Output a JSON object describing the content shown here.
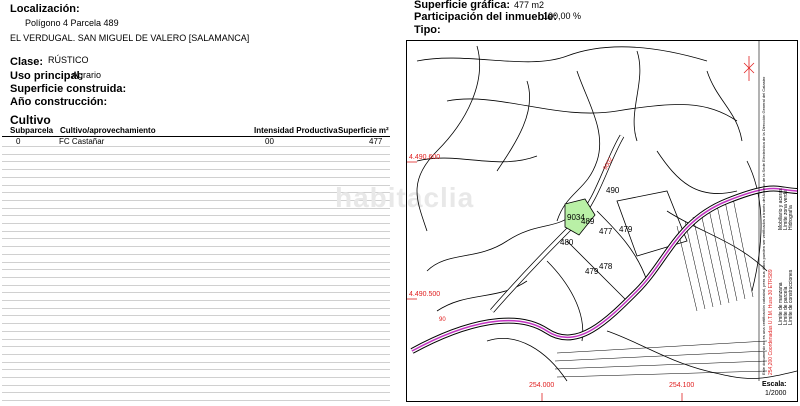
{
  "left": {
    "localizacion_label": "Localización:",
    "localizacion_line1": "Polígono 4 Parcela 489",
    "localizacion_line2": "EL VERDUGAL. SAN MIGUEL DE VALERO [SALAMANCA]",
    "clase_label": "Clase:",
    "clase_value": "RÚSTICO",
    "uso_label": "Uso principal:",
    "uso_value": "Agrario",
    "superficie_label": "Superficie construida:",
    "anio_label": "Año construcción:",
    "cultivo_title": "Cultivo",
    "table": {
      "headers": [
        "Subparcela",
        "Cultivo/aprovechamiento",
        "Intensidad Productiva",
        "Superficie m²"
      ],
      "rows": [
        [
          "0",
          "FC Castañar",
          "00",
          "477"
        ]
      ]
    }
  },
  "right": {
    "superficie_grafica_label": "Superficie gráfica:",
    "superficie_grafica_value": "477 m2",
    "participacion_label": "Participación del inmueble:",
    "participacion_value": "100,00 %",
    "tipo_label": "Tipo:"
  },
  "watermark": "habitaclia",
  "map": {
    "parcel_labels": [
      "490",
      "9034",
      "489",
      "477",
      "479",
      "480",
      "479",
      "478"
    ],
    "coord_left_top": "4.490.600",
    "coord_left_bottom": "4.490.500",
    "coord_bottom_left": "254.000",
    "coord_bottom_right": "254.100",
    "road_label": "9002",
    "road_label_2": "90",
    "escala_label": "Escala:",
    "escala_value": "1/2000",
    "legend": [
      "Límite de manzana",
      "Límite de parcela",
      "Límite de construcciones",
      "Mobiliario y aceras",
      "Límite zona verde",
      "Hidrografía"
    ],
    "footnote_1": "254,200 Coordenadas U.T.M. Huso 30 ETRS89",
    "footnote_2": "Este documento no es una certificación catastral, pero sus datos pueden ser verificados a través del Acceso de la Sede Electrónica de la Dirección General del Catastro",
    "colors": {
      "road": "#c233c2",
      "parcel_fill": "#b9f0a6",
      "coord": "#e02020"
    }
  }
}
